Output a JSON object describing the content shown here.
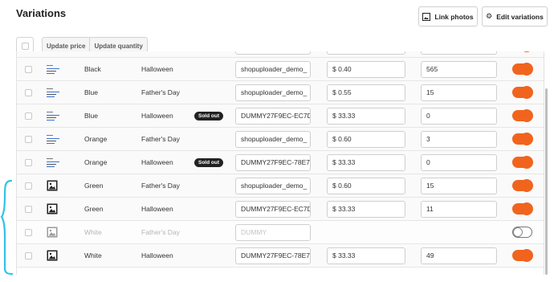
{
  "header": {
    "title": "Variations",
    "link_photos_label": "Link photos",
    "edit_variations_label": "Edit variations"
  },
  "bulk_actions": {
    "update_price_label": "Update price",
    "update_quantity_label": "Update quantity"
  },
  "rows": [
    {
      "thumb": "listing-thumbnail",
      "color": "Black",
      "holiday": "Halloween",
      "badge": "",
      "sku": "shopuploader_demo_",
      "price": "$ 0.40",
      "quantity": "565",
      "enabled": true
    },
    {
      "thumb": "listing-thumbnail",
      "color": "Blue",
      "holiday": "Father's Day",
      "badge": "",
      "sku": "shopuploader_demo_",
      "price": "$ 0.55",
      "quantity": "15",
      "enabled": true
    },
    {
      "thumb": "listing-thumbnail",
      "color": "Blue",
      "holiday": "Halloween",
      "badge": "Sold out",
      "sku": "DUMMY27F9EC-EC7D",
      "price": "$ 33.33",
      "quantity": "0",
      "enabled": true
    },
    {
      "thumb": "listing-thumbnail",
      "color": "Orange",
      "holiday": "Father's Day",
      "badge": "",
      "sku": "shopuploader_demo_",
      "price": "$ 0.60",
      "quantity": "3",
      "enabled": true
    },
    {
      "thumb": "listing-thumbnail",
      "color": "Orange",
      "holiday": "Halloween",
      "badge": "Sold out",
      "sku": "DUMMY27F9EC-78E7-",
      "price": "$ 33.33",
      "quantity": "0",
      "enabled": true
    },
    {
      "thumb": "image-placeholder-icon",
      "color": "Green",
      "holiday": "Father's Day",
      "badge": "",
      "sku": "shopuploader_demo_",
      "price": "$ 0.60",
      "quantity": "15",
      "enabled": true
    },
    {
      "thumb": "image-placeholder-icon",
      "color": "Green",
      "holiday": "Halloween",
      "badge": "",
      "sku": "DUMMY27F9EC-EC7D",
      "price": "$ 33.33",
      "quantity": "11",
      "enabled": true
    },
    {
      "thumb": "image-placeholder-icon",
      "color": "White",
      "holiday": "Father's Day",
      "badge": "",
      "sku": "DUMMY",
      "price": "",
      "quantity": "",
      "enabled": false
    },
    {
      "thumb": "image-placeholder-icon",
      "color": "White",
      "holiday": "Halloween",
      "badge": "",
      "sku": "DUMMY27F9EC-78E7-",
      "price": "$ 33.33",
      "quantity": "49",
      "enabled": true
    }
  ],
  "colors": {
    "toggle_on": "#f1641e",
    "annotation_bracket": "#2ec4e6",
    "sold_out_badge": "#222222"
  }
}
